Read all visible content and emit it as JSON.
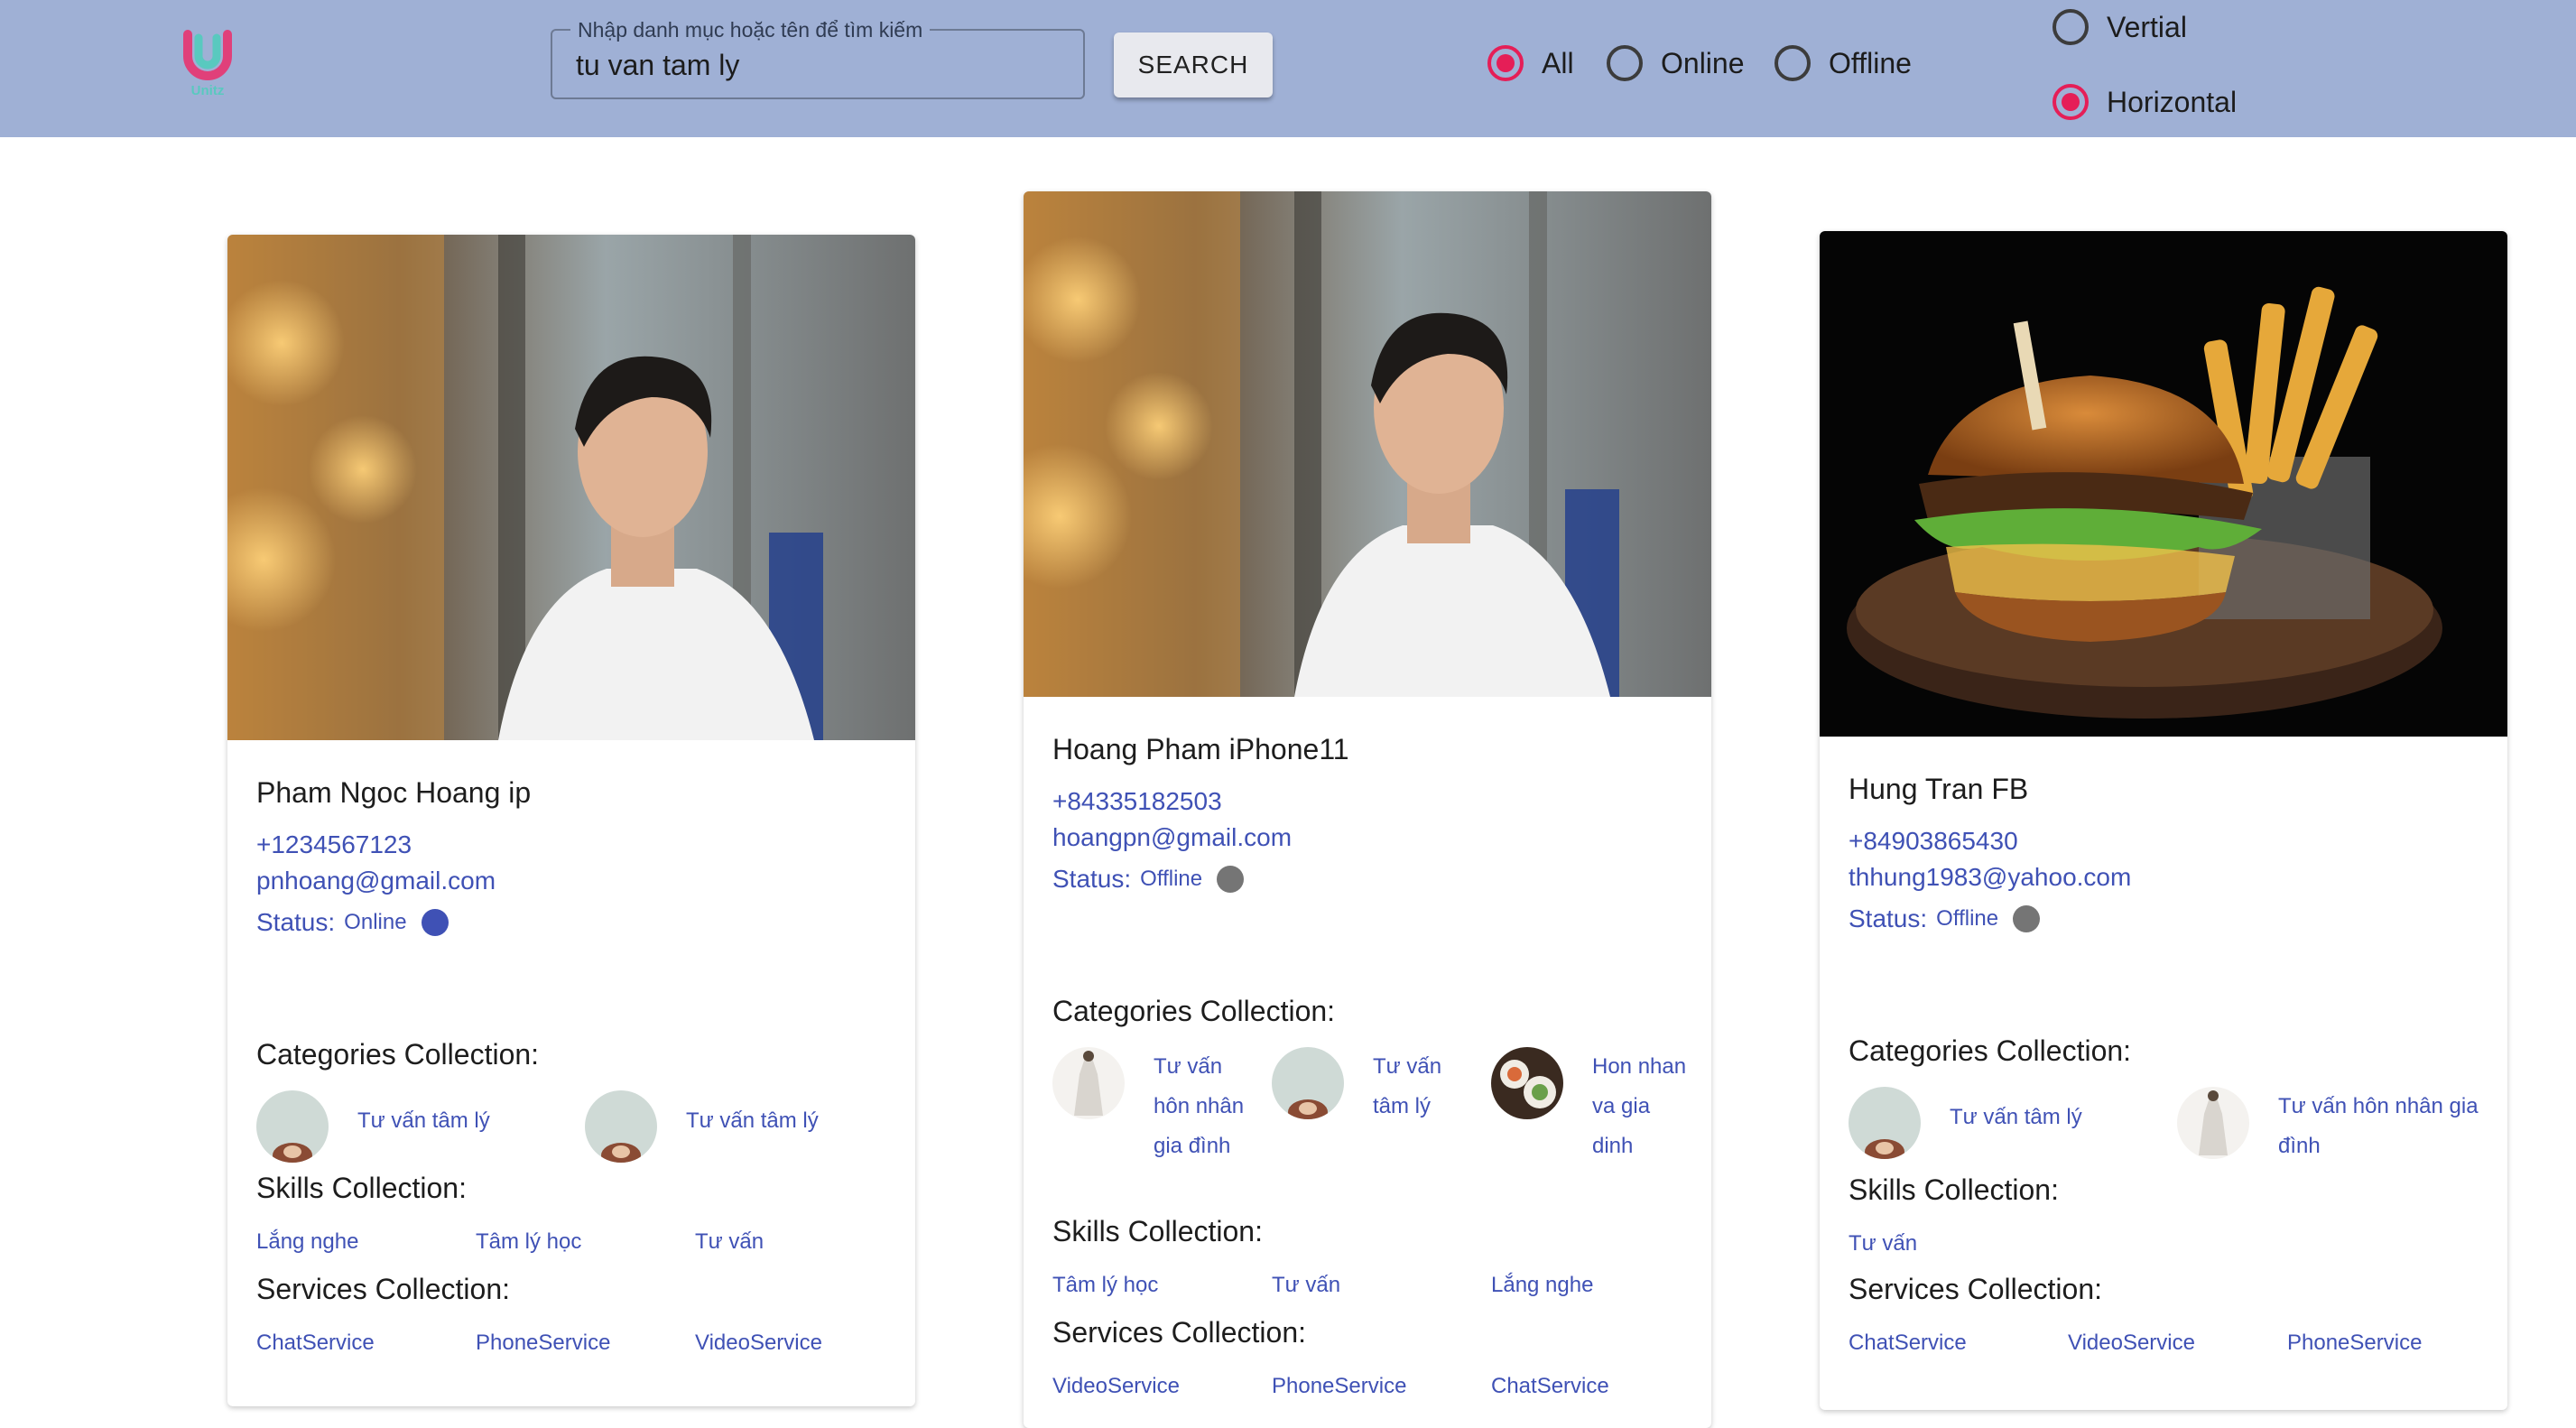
{
  "header": {
    "logo_text": "Unitz",
    "search": {
      "label": "Nhập danh mục hoặc tên để tìm kiếm",
      "value": "tu van tam ly"
    },
    "search_button": "SEARCH",
    "status_filter": [
      {
        "label": "All",
        "selected": true
      },
      {
        "label": "Online",
        "selected": false
      },
      {
        "label": "Offline",
        "selected": false
      }
    ],
    "layout_option": [
      {
        "label": "Vertial",
        "selected": false
      },
      {
        "label": "Horizontal",
        "selected": true
      }
    ]
  },
  "labels": {
    "status": "Status:",
    "categories": "Categories Collection:",
    "skills": "Skills Collection:",
    "services": "Services Collection:"
  },
  "colors": {
    "accent": "#e51e57",
    "link": "#3f51b5",
    "online": "#3f51b5",
    "offline": "#757575",
    "header_bg": "#9fb0d5"
  },
  "cards": [
    {
      "photo": "portrait-man-bar",
      "name": "Pham Ngoc Hoang ip",
      "phone": "+1234567123",
      "email": "pnhoang@gmail.com",
      "status": "Online",
      "categories": [
        {
          "label": "Tư vấn tâm lý",
          "avatar": "hands-avatar"
        },
        {
          "label": "Tư vấn tâm lý",
          "avatar": "hands-avatar"
        }
      ],
      "skills": [
        "Lắng nghe",
        "Tâm lý học",
        "Tư vấn"
      ],
      "services": [
        "ChatService",
        "PhoneService",
        "VideoService"
      ]
    },
    {
      "photo": "portrait-man-bar",
      "name": "Hoang Pham iPhone11",
      "phone": "+84335182503",
      "email": "hoangpn@gmail.com",
      "status": "Offline",
      "categories": [
        {
          "label": "Tư vấn hôn nhân gia đình",
          "avatar": "dress-avatar"
        },
        {
          "label": "Tư vấn tâm lý",
          "avatar": "hands-avatar"
        },
        {
          "label": "Hon nhan va gia dinh",
          "avatar": "food-avatar"
        }
      ],
      "skills": [
        "Tâm lý học",
        "Tư vấn",
        "Lắng nghe"
      ],
      "services": [
        "VideoService",
        "PhoneService",
        "ChatService"
      ]
    },
    {
      "photo": "burger-fries",
      "name": "Hung Tran FB",
      "phone": "+84903865430",
      "email": "thhung1983@yahoo.com",
      "status": "Offline",
      "categories": [
        {
          "label": "Tư vấn tâm lý",
          "avatar": "hands-avatar"
        },
        {
          "label": "Tư vấn hôn nhân gia đình",
          "avatar": "dress-avatar"
        }
      ],
      "skills": [
        "Tư vấn"
      ],
      "services": [
        "ChatService",
        "VideoService",
        "PhoneService"
      ]
    }
  ]
}
